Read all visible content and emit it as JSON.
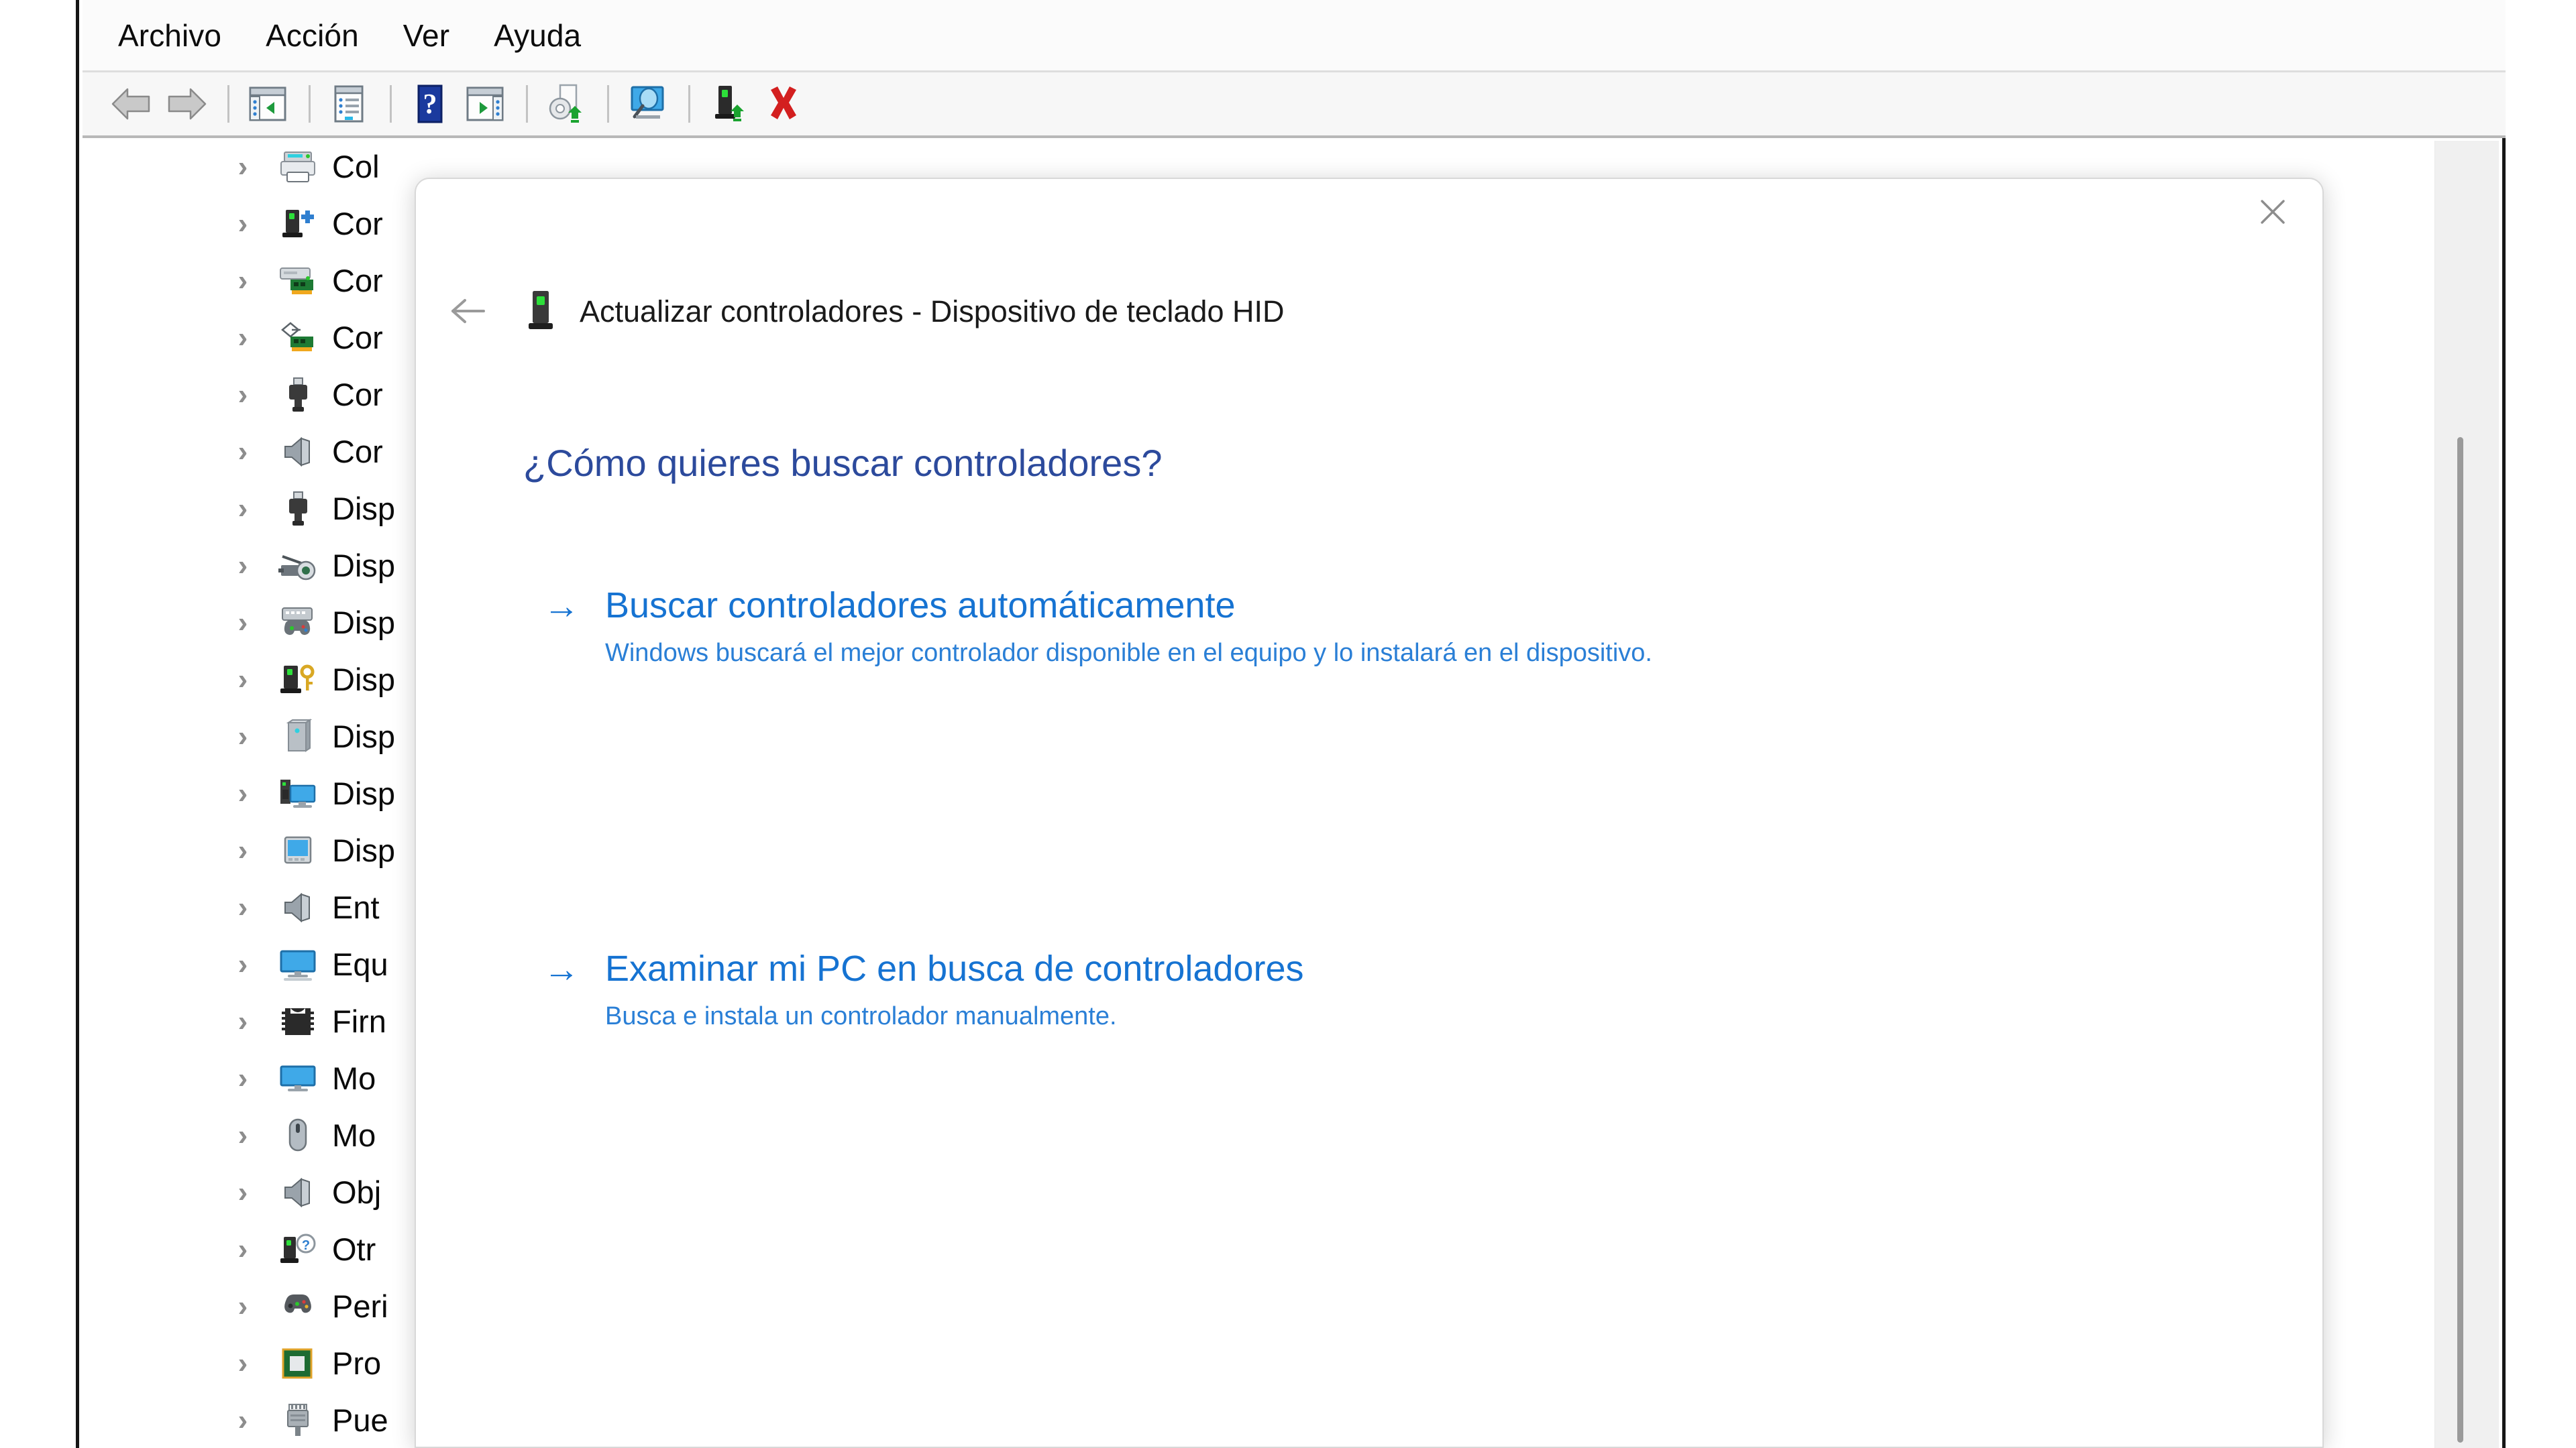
{
  "window": {
    "menubar": [
      {
        "label": "Archivo",
        "name": "menu-archivo"
      },
      {
        "label": "Acción",
        "name": "menu-accion"
      },
      {
        "label": "Ver",
        "name": "menu-ver"
      },
      {
        "label": "Ayuda",
        "name": "menu-ayuda"
      }
    ],
    "toolbar": [
      {
        "icon": "back-arrow-icon",
        "title": "Atrás"
      },
      {
        "icon": "forward-arrow-icon",
        "title": "Adelante"
      },
      {
        "icon": "show-hide-console-tree-icon",
        "title": "Mostrar/ocultar árbol de consola"
      },
      {
        "icon": "properties-icon",
        "title": "Propiedades"
      },
      {
        "icon": "help-icon",
        "title": "Ayuda"
      },
      {
        "icon": "show-hide-action-pane-icon",
        "title": "Mostrar/ocultar panel de acciones"
      },
      {
        "icon": "update-driver-icon",
        "title": "Actualizar controlador"
      },
      {
        "icon": "scan-hardware-changes-icon",
        "title": "Buscar cambios de hardware"
      },
      {
        "icon": "enable-device-icon",
        "title": "Habilitar dispositivo"
      },
      {
        "icon": "uninstall-device-icon",
        "title": "Desinstalar dispositivo"
      }
    ]
  },
  "tree": {
    "items": [
      {
        "label": "Col",
        "icon": "printer-icon"
      },
      {
        "label": "Cor",
        "icon": "device-plugin-icon"
      },
      {
        "label": "Cor",
        "icon": "drive-card-icon"
      },
      {
        "label": "Cor",
        "icon": "network-card-icon"
      },
      {
        "label": "Cor",
        "icon": "usb-connector-icon"
      },
      {
        "label": "Cor",
        "icon": "speaker-icon"
      },
      {
        "label": "Disp",
        "icon": "usb-connector-icon"
      },
      {
        "label": "Disp",
        "icon": "camera-icon"
      },
      {
        "label": "Disp",
        "icon": "keyboard-gamepad-icon"
      },
      {
        "label": "Disp",
        "icon": "device-key-icon"
      },
      {
        "label": "Disp",
        "icon": "storage-box-icon"
      },
      {
        "label": "Disp",
        "icon": "computer-monitor-tower-icon"
      },
      {
        "label": "Disp",
        "icon": "portable-screen-icon"
      },
      {
        "label": "Ent",
        "icon": "speaker-icon"
      },
      {
        "label": "Equ",
        "icon": "monitor-icon"
      },
      {
        "label": "Firn",
        "icon": "chip-firmware-icon"
      },
      {
        "label": "Mo",
        "icon": "monitor-blue-icon"
      },
      {
        "label": "Mo",
        "icon": "mouse-icon"
      },
      {
        "label": "Obj",
        "icon": "speaker-icon"
      },
      {
        "label": "Otr",
        "icon": "unknown-device-icon"
      },
      {
        "label": "Peri",
        "icon": "gamepad-icon"
      },
      {
        "label": "Pro",
        "icon": "processor-icon"
      },
      {
        "label": "Pue",
        "icon": "port-connector-icon"
      }
    ]
  },
  "dialog": {
    "title": "Actualizar controladores - Dispositivo de teclado HID",
    "close_label": "✕",
    "back_label": "←",
    "question": "¿Cómo quieres buscar controladores?",
    "options": [
      {
        "arrow": "→",
        "title": "Buscar controladores automáticamente",
        "description": "Windows buscará el mejor controlador disponible en el equipo y lo instalará en el dispositivo."
      },
      {
        "arrow": "→",
        "title": "Examinar mi PC en busca de controladores",
        "description": "Busca e instala un controlador manualmente."
      }
    ]
  },
  "colors": {
    "link_blue": "#1673d2",
    "desc_blue": "#2a7fd6",
    "heading_blue": "#2c4a9c",
    "window_border": "#161616"
  }
}
